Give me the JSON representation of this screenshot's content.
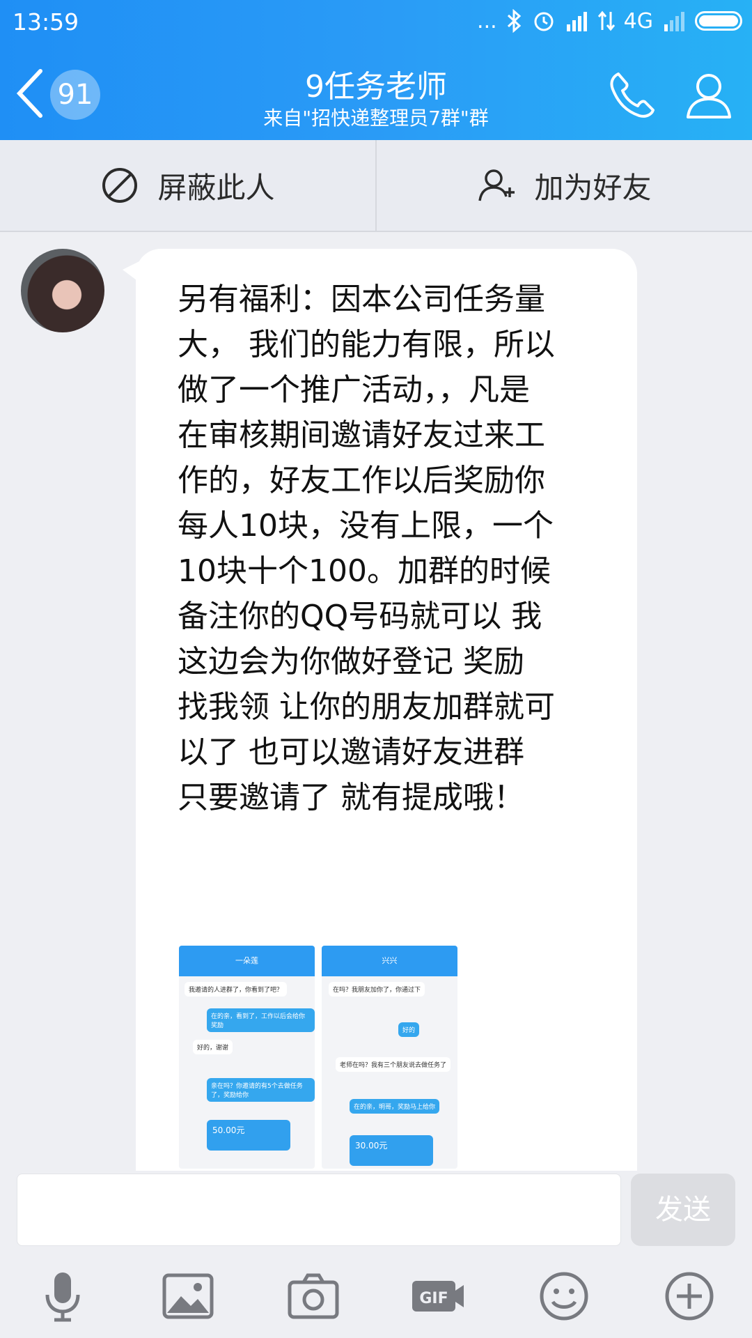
{
  "status_bar": {
    "time": "13:59",
    "dots": "...",
    "network": "4G"
  },
  "header": {
    "back_count": "91",
    "title": "9任务老师",
    "subtitle": "来自\"招快递整理员7群\"群"
  },
  "actions": {
    "block_label": "屏蔽此人",
    "add_friend_label": "加为好友"
  },
  "message": {
    "text": "另有福利：因本公司任务量\n大， 我们的能力有限，所以\n做了一个推广活动，，凡是\n在审核期间邀请好友过来工\n作的，好友工作以后奖励你\n每人10块，没有上限，一个\n10块十个100。加群的时候\n备注你的QQ号码就可以  我\n这边会为你做好登记  奖励\n找我领 让你的朋友加群就可\n以了  也可以邀请好友进群\n只要邀请了 就有提成哦！"
  },
  "thumbnails": {
    "left": {
      "title": "一朵莲",
      "lines": [
        "我邀请的人进群了，你看到了吧？",
        "在的亲，看到了，工作以后会给你奖励",
        "好的，谢谢",
        "亲在吗？你邀请的有5个去做任务了，奖励给你"
      ],
      "money": "50.00元"
    },
    "right": {
      "title": "兴兴",
      "lines": [
        "在吗？我朋友加你了，你通过下",
        "好的",
        "老师在吗？我有三个朋友说去做任务了",
        "在的亲，明哥，奖励马上给你"
      ],
      "money": "30.00元"
    }
  },
  "input": {
    "placeholder": "",
    "send_label": "发送"
  },
  "toolbar": {
    "gif_label": "GIF"
  }
}
